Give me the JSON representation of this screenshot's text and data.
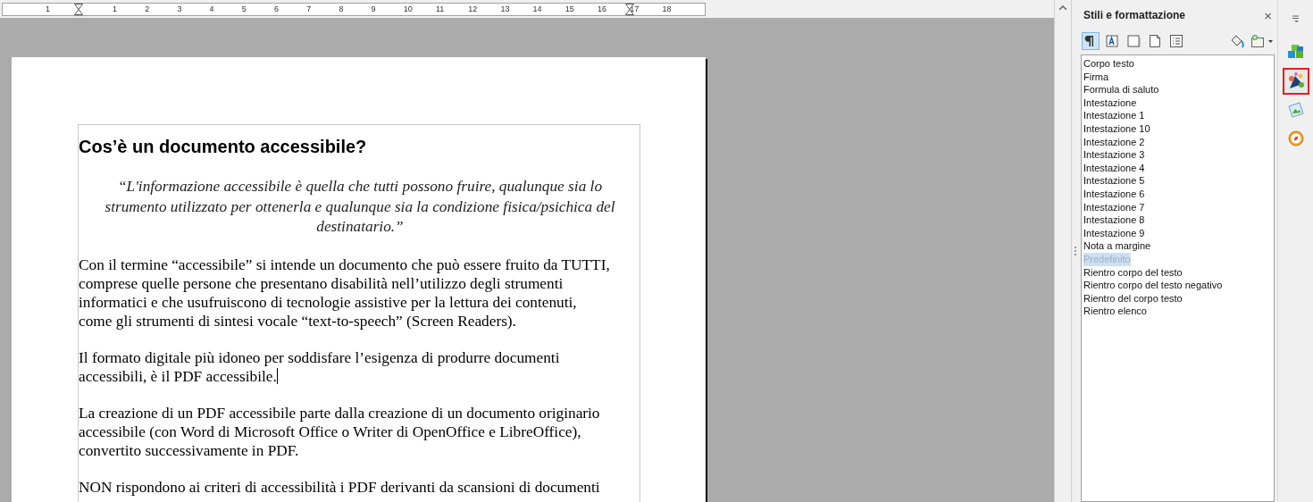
{
  "ruler": {
    "labels": [
      "1",
      "1",
      "2",
      "3",
      "4",
      "5",
      "6",
      "7",
      "8",
      "9",
      "10",
      "11",
      "12",
      "13",
      "14",
      "15",
      "16",
      "17",
      "18"
    ]
  },
  "document": {
    "heading": "Cos’è un documento accessibile?",
    "quote_lines": [
      "“L'informazione accessibile è quella che tutti possono fruire, qualunque sia lo",
      "strumento utilizzato per ottenerla e qualunque sia la condizione fisica/psichica del",
      "destinatario.”"
    ],
    "paragraphs": [
      {
        "lines": [
          "Con il termine “accessibile” si intende un documento che può essere fruito da TUTTI,",
          "comprese quelle persone che presentano disabilità nell’utilizzo degli strumenti",
          "informatici e che usufruiscono di tecnologie assistive per la lettura dei contenuti,",
          "come gli strumenti di sintesi vocale “text-to-speech” (Screen Readers)."
        ],
        "has_cursor": false
      },
      {
        "lines": [
          "Il formato digitale più idoneo per soddisfare l’esigenza di produrre documenti",
          "accessibili, è il PDF accessibile."
        ],
        "has_cursor": true
      },
      {
        "lines": [
          "La creazione di un PDF accessibile parte dalla creazione di un documento originario",
          "accessibile (con Word di Microsoft Office o Writer di OpenOffice e LibreOffice),",
          "convertito successivamente in PDF."
        ],
        "has_cursor": false
      },
      {
        "lines": [
          "NON rispondono ai criteri di accessibilità i PDF derivanti da scansioni di documenti"
        ],
        "has_cursor": false
      }
    ]
  },
  "sidebar": {
    "title": "Stili e formattazione",
    "close": "×",
    "categories": [
      {
        "kind": "paragraph",
        "selected": true
      },
      {
        "kind": "character",
        "selected": false
      },
      {
        "kind": "frame",
        "selected": false
      },
      {
        "kind": "page",
        "selected": false
      },
      {
        "kind": "list",
        "selected": false
      }
    ],
    "styles": [
      {
        "label": "Corpo testo",
        "selected": false
      },
      {
        "label": "Firma",
        "selected": false
      },
      {
        "label": "Formula di saluto",
        "selected": false
      },
      {
        "label": "Intestazione",
        "selected": false
      },
      {
        "label": "Intestazione 1",
        "selected": false
      },
      {
        "label": "Intestazione 10",
        "selected": false
      },
      {
        "label": "Intestazione 2",
        "selected": false
      },
      {
        "label": "Intestazione 3",
        "selected": false
      },
      {
        "label": "Intestazione 4",
        "selected": false
      },
      {
        "label": "Intestazione 5",
        "selected": false
      },
      {
        "label": "Intestazione 6",
        "selected": false
      },
      {
        "label": "Intestazione 7",
        "selected": false
      },
      {
        "label": "Intestazione 8",
        "selected": false
      },
      {
        "label": "Intestazione 9",
        "selected": false
      },
      {
        "label": "Nota a margine",
        "selected": false
      },
      {
        "label": "Predefinito",
        "selected": true
      },
      {
        "label": "Rientro corpo del testo",
        "selected": false
      },
      {
        "label": "Rientro corpo del testo negativo",
        "selected": false
      },
      {
        "label": "Rientro del corpo testo",
        "selected": false
      },
      {
        "label": "Rientro elenco",
        "selected": false
      }
    ]
  },
  "deck_tabs": [
    {
      "kind": "menu",
      "selected": false
    },
    {
      "kind": "properties",
      "selected": false
    },
    {
      "kind": "styles",
      "selected": true
    },
    {
      "kind": "gallery",
      "selected": false
    },
    {
      "kind": "navigator",
      "selected": false
    }
  ]
}
